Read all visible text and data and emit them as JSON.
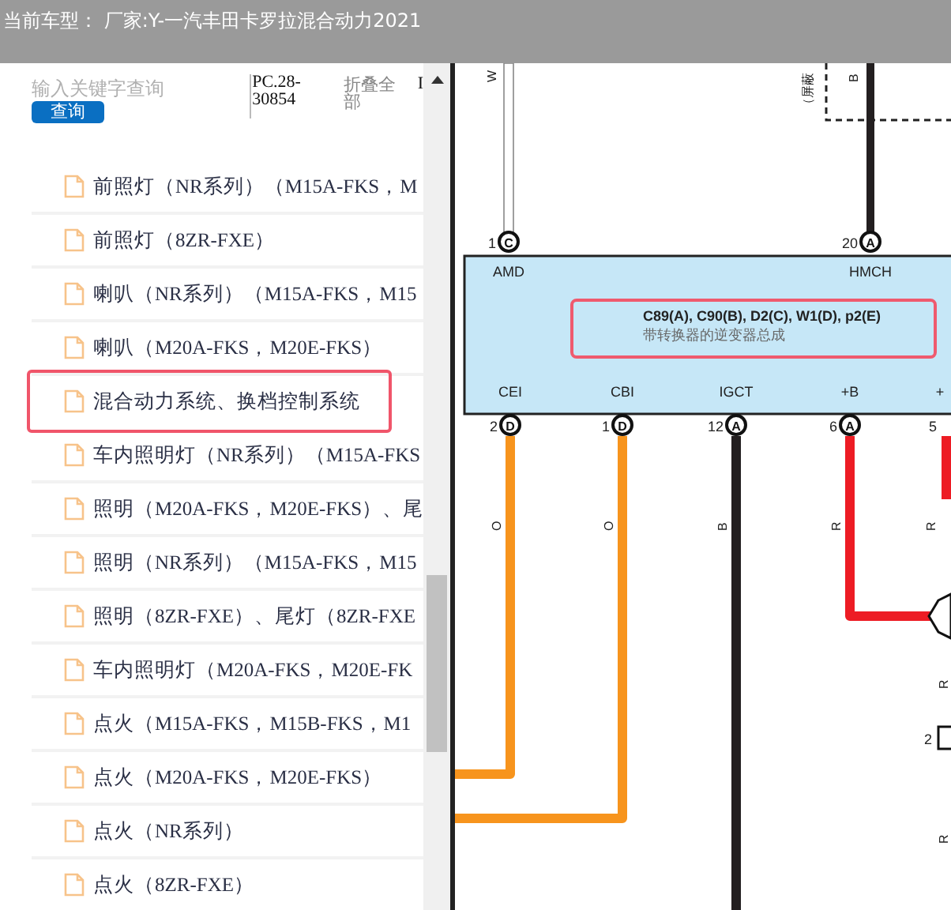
{
  "header": {
    "title": "当前车型： 厂家:Y-一汽丰田卡罗拉混合动力2021"
  },
  "toolbar": {
    "search": {
      "placeholder": "输入关键字查询"
    },
    "search_button": "查询",
    "code": "PC.28-30854",
    "collapse": "折叠全部",
    "column_4": "I"
  },
  "list": [
    {
      "label": "前照灯（NR系列）（M15A-FKS，M",
      "selected": false
    },
    {
      "label": "前照灯（8ZR-FXE）",
      "selected": false
    },
    {
      "label": "喇叭（NR系列）（M15A-FKS，M15",
      "selected": false
    },
    {
      "label": "喇叭（M20A-FKS，M20E-FKS）",
      "selected": false
    },
    {
      "label": "混合动力系统、换档控制系统",
      "selected": true
    },
    {
      "label": "车内照明灯（NR系列）（M15A-FKS",
      "selected": false
    },
    {
      "label": "照明（M20A-FKS，M20E-FKS）、尾",
      "selected": false
    },
    {
      "label": "照明（NR系列）（M15A-FKS，M15",
      "selected": false
    },
    {
      "label": "照明（8ZR-FXE）、尾灯（8ZR-FXE",
      "selected": false
    },
    {
      "label": "车内照明灯（M20A-FKS，M20E-FK",
      "selected": false
    },
    {
      "label": "点火（M15A-FKS，M15B-FKS，M1",
      "selected": false
    },
    {
      "label": "点火（M20A-FKS，M20E-FKS）",
      "selected": false
    },
    {
      "label": "点火（NR系列）",
      "selected": false
    },
    {
      "label": "点火（8ZR-FXE）",
      "selected": false
    }
  ],
  "diagram": {
    "shield_label": "（屏蔽",
    "top_pins": [
      {
        "wire_label": "W",
        "number": "1",
        "pin": "C",
        "signal": "AMD",
        "kind": "double"
      },
      {
        "wire_label": "B",
        "number": "20",
        "pin": "A",
        "signal": "HMCH",
        "kind": "solid"
      }
    ],
    "component": {
      "connectors": "C89(A), C90(B), D2(C), W1(D), p2(E)",
      "name": "带转换器的逆变器总成"
    },
    "bottom_pins": [
      {
        "signal": "CEI",
        "number": "2",
        "pin": "D",
        "wire_label": "O",
        "color": "#f7941d"
      },
      {
        "signal": "CBI",
        "number": "1",
        "pin": "D",
        "wire_label": "O",
        "color": "#f7941d"
      },
      {
        "signal": "IGCT",
        "number": "12",
        "pin": "A",
        "wire_label": "B",
        "color": "#231f20"
      },
      {
        "signal": "+B",
        "number": "6",
        "pin": "A",
        "wire_label": "R",
        "color": "#ed1c24"
      },
      {
        "signal": "+",
        "number": "5",
        "wire_label": "R",
        "color": "#ed1c24"
      }
    ],
    "side_labels": [
      "R",
      "R"
    ],
    "side_pin": {
      "number": "2"
    }
  }
}
